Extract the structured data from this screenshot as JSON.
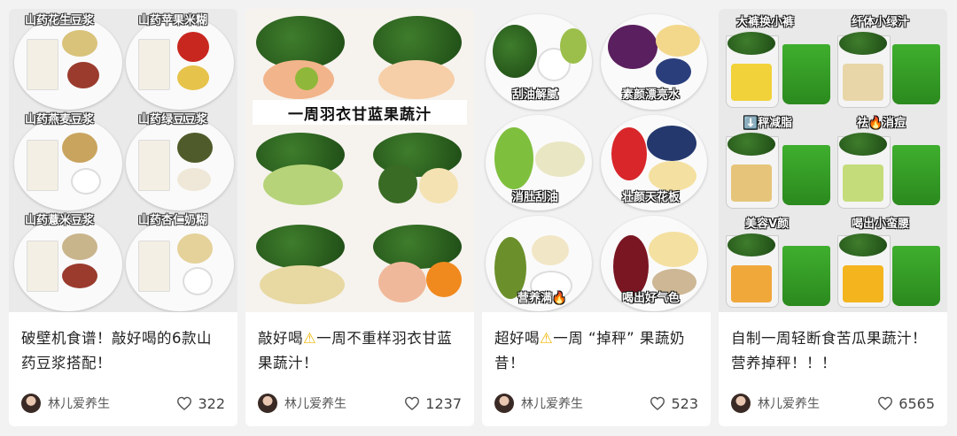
{
  "cards": [
    {
      "title": "破壁机食谱！敲好喝的6款山药豆浆搭配！",
      "author": "林儿爱养生",
      "likes": "322",
      "cover_labels": [
        "山药花生豆浆",
        "山药苹果米糊",
        "山药燕麦豆浆",
        "山药绿豆豆浆",
        "山药薏米豆浆",
        "山药杏仁奶糊"
      ]
    },
    {
      "title_part1": "敲好喝",
      "title_part2": "一周不重样羽衣甘蓝果蔬汁！",
      "author": "林儿爱养生",
      "likes": "1237",
      "cover_banner": "一周羽衣甘蓝果蔬汁"
    },
    {
      "title_part1": "超好喝",
      "title_part2": "一周 “掉秤” 果蔬奶昔！",
      "author": "林儿爱养生",
      "likes": "523",
      "cover_labels": [
        "刮油解腻",
        "素颜漂亮水",
        "消肚刮油",
        "壮颜天花板",
        "营养满🔥",
        "喝出好气色"
      ]
    },
    {
      "title": "自制一周轻断食苦瓜果蔬汁！营养掉秤！！！",
      "author": "林儿爱养生",
      "likes": "6565",
      "cover_labels": [
        "大裤换小裤",
        "纤体小绿汁",
        "⬇️秤减脂",
        "祛🔥消痘",
        "美容V颜",
        "喝出小蛮腰"
      ]
    }
  ],
  "colors": {
    "warning": "#f0b400",
    "kale": "#2e6b22",
    "juice": "#3fae2e"
  }
}
